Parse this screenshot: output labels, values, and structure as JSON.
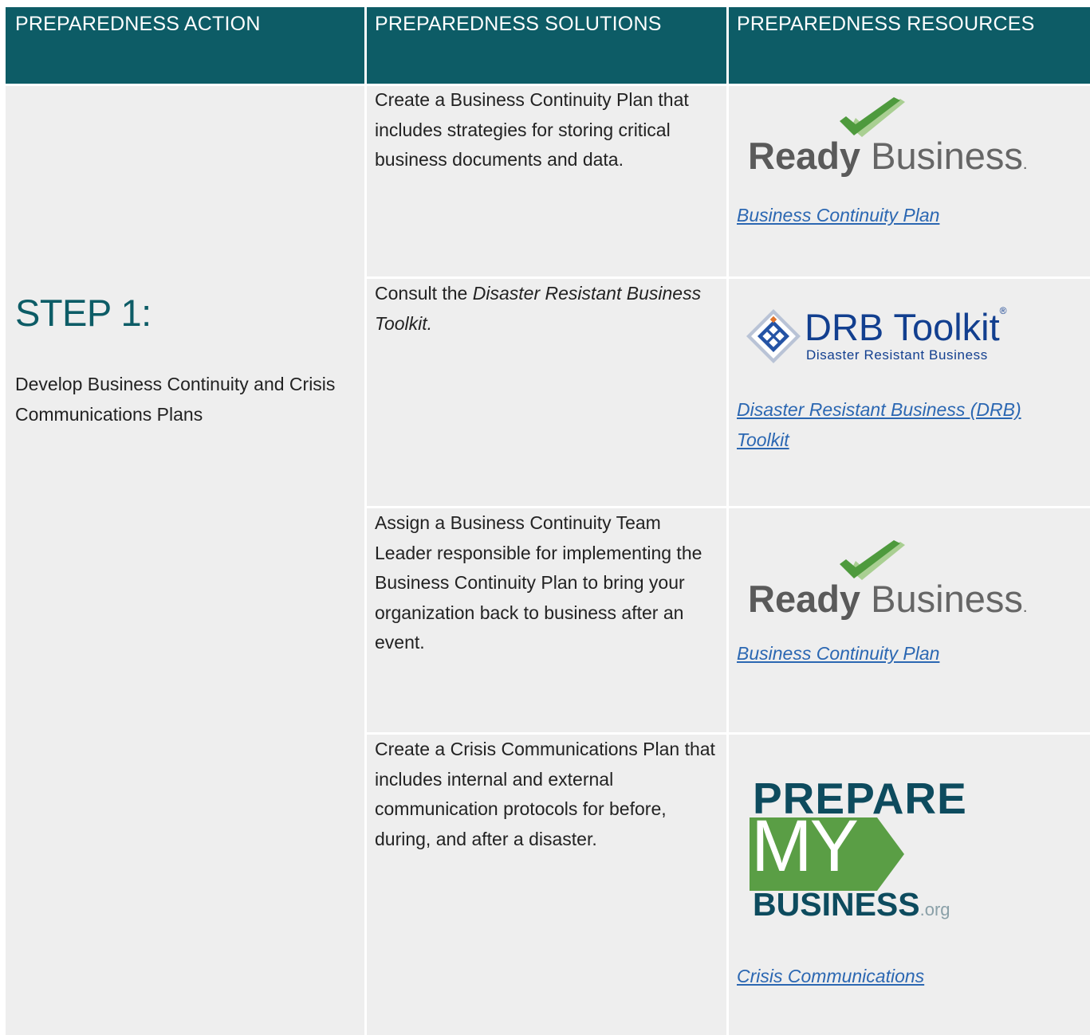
{
  "headers": {
    "action": "PREPAREDNESS ACTION",
    "solutions": "PREPAREDNESS SOLUTIONS",
    "resources": "PREPAREDNESS RESOURCES"
  },
  "step": {
    "title": "STEP 1:",
    "description": "Develop Business Continuity and Crisis Communications Plans"
  },
  "rows": [
    {
      "solution": "Create a Business Continuity Plan that includes strategies for storing critical business documents and data.",
      "logo": "ready-business",
      "link": "Business Continuity Plan"
    },
    {
      "solution_prefix": "Consult the ",
      "solution_italic": "Disaster Resistant Business Toolkit.",
      "logo": "drb-toolkit",
      "link": "Disaster Resistant Business (DRB) Toolkit"
    },
    {
      "solution": "Assign a Business Continuity Team Leader responsible for implementing the Business Continuity Plan to bring your organization back to business after an event.",
      "logo": "ready-business",
      "link": "Business Continuity Plan"
    },
    {
      "solution": "Create a Crisis Communications Plan that includes internal and external communication protocols for before, during, and after a disaster.",
      "logo": "prepare-my-business",
      "link": "Crisis Communications"
    }
  ],
  "logos": {
    "ready_business": {
      "bold": "Ready",
      "light": "Business",
      "dot": "."
    },
    "drb_toolkit": {
      "main": "DRB Toolkit",
      "reg": "®",
      "sub": "Disaster Resistant Business"
    },
    "prepare_my_business": {
      "line1": "PREPARE",
      "line2": "MY",
      "line3": "BUSINESS",
      "tld": ".org"
    }
  },
  "colors": {
    "header_bg": "#0d5c66",
    "cell_bg": "#eeeeee",
    "link": "#2b67b2",
    "check_green": "#4e9a3d",
    "pmb_green": "#5a9e45",
    "drb_blue": "#123f8f"
  }
}
